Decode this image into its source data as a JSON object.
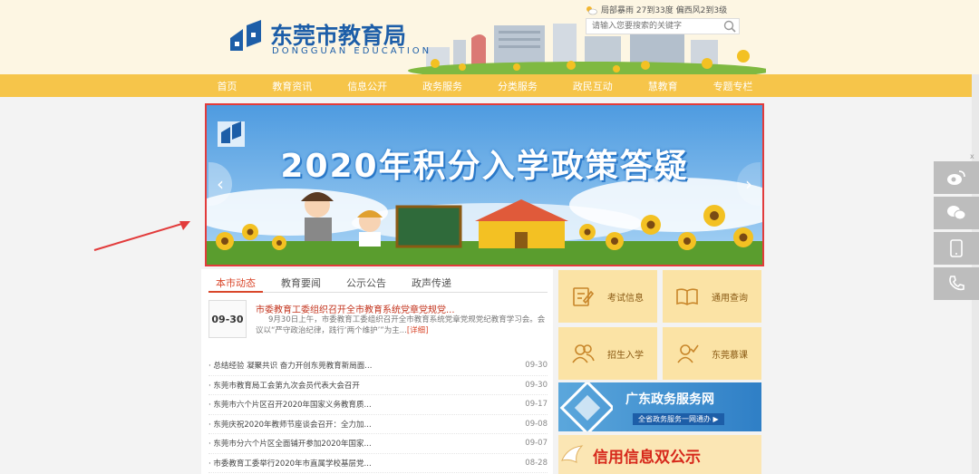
{
  "header": {
    "logo_cn": "东莞市教育局",
    "logo_en": "DONGGUAN EDUCATION",
    "weather": "局部暴雨 27到33度 偏西风2到3级",
    "search_placeholder": "请输入您要搜索的关键字"
  },
  "nav": {
    "items": [
      "首页",
      "教育资讯",
      "信息公开",
      "政务服务",
      "分类服务",
      "政民互动",
      "慧教育",
      "专题专栏"
    ]
  },
  "banner": {
    "title": "2020年积分入学政策答疑",
    "prev": "‹",
    "next": "›"
  },
  "news": {
    "tabs": [
      "本市动态",
      "教育要闻",
      "公示公告",
      "政声传递"
    ],
    "featured": {
      "date": "09-30",
      "title": "市委教育工委组织召开全市教育系统党章党规党...",
      "summary": "9月30日上午，市委教育工委组织召开全市教育系统党章党规党纪教育学习会。会议以“严守政治纪律，践行‘两个维护’”为主...",
      "more": "[详细]"
    },
    "items": [
      {
        "title": "· 总结经验 凝聚共识 奋力开创东莞教育新局面...",
        "date": "09-30"
      },
      {
        "title": "· 东莞市教育局工会第九次会员代表大会召开",
        "date": "09-30"
      },
      {
        "title": "· 东莞市六个片区召开2020年国家义务教育质...",
        "date": "09-17"
      },
      {
        "title": "· 东莞庆祝2020年教师节座谈会召开：全力加...",
        "date": "09-08"
      },
      {
        "title": "· 东莞市分六个片区全面铺开参加2020年国家...",
        "date": "09-07"
      },
      {
        "title": "· 市委教育工委举行2020年市直属学校基层党...",
        "date": "08-28"
      }
    ]
  },
  "services": {
    "items": [
      {
        "label": "考试信息",
        "icon": "edit-icon"
      },
      {
        "label": "通用查询",
        "icon": "book-icon"
      },
      {
        "label": "招生入学",
        "icon": "users-icon"
      },
      {
        "label": "东莞慕课",
        "icon": "user-check-icon"
      }
    ],
    "gov_title": "广东政务服务网",
    "gov_sub": "全省政务服务一网通办 ▶",
    "credit_title": "信用信息双公示"
  },
  "side": {
    "close": "x",
    "tools": [
      "weibo-icon",
      "wechat-icon",
      "mobile-icon",
      "phone-icon"
    ]
  },
  "colors": {
    "nav": "#f6c54a",
    "brand": "#1d5ea8",
    "accent": "#d9472b",
    "highlight_border": "#e23b3b"
  }
}
